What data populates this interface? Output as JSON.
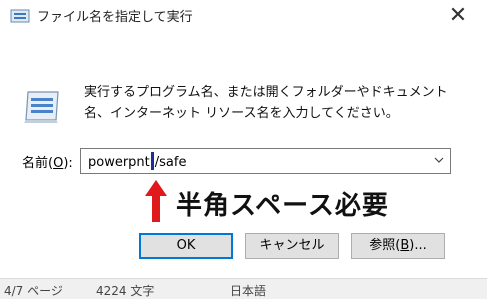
{
  "window": {
    "title": "ファイル名を指定して実行",
    "close_glyph": "✕"
  },
  "description": "実行するプログラム名、または開くフォルダーやドキュメント名、インターネット リソース名を入力してください。",
  "field": {
    "label_prefix": "名前(",
    "label_accel": "O",
    "label_suffix": "):",
    "value_before_caret": "powerpnt",
    "value_after_caret": "/safe"
  },
  "annotation": {
    "text": "半角スペース必要",
    "color": "#e0191c"
  },
  "buttons": {
    "ok": "OK",
    "cancel": "キャンセル",
    "browse_prefix": "参照(",
    "browse_accel": "B",
    "browse_suffix": ")..."
  },
  "statusbar": {
    "page": "4/7 ページ",
    "words": "4224 文字",
    "language": "日本語"
  },
  "colors": {
    "accent": "#0078d7",
    "caret": "#1a2e9c"
  },
  "icons": {
    "title": "run-icon",
    "dialog": "run-icon",
    "dropdown": "chevron-down-icon",
    "annotation": "up-arrow-icon"
  }
}
